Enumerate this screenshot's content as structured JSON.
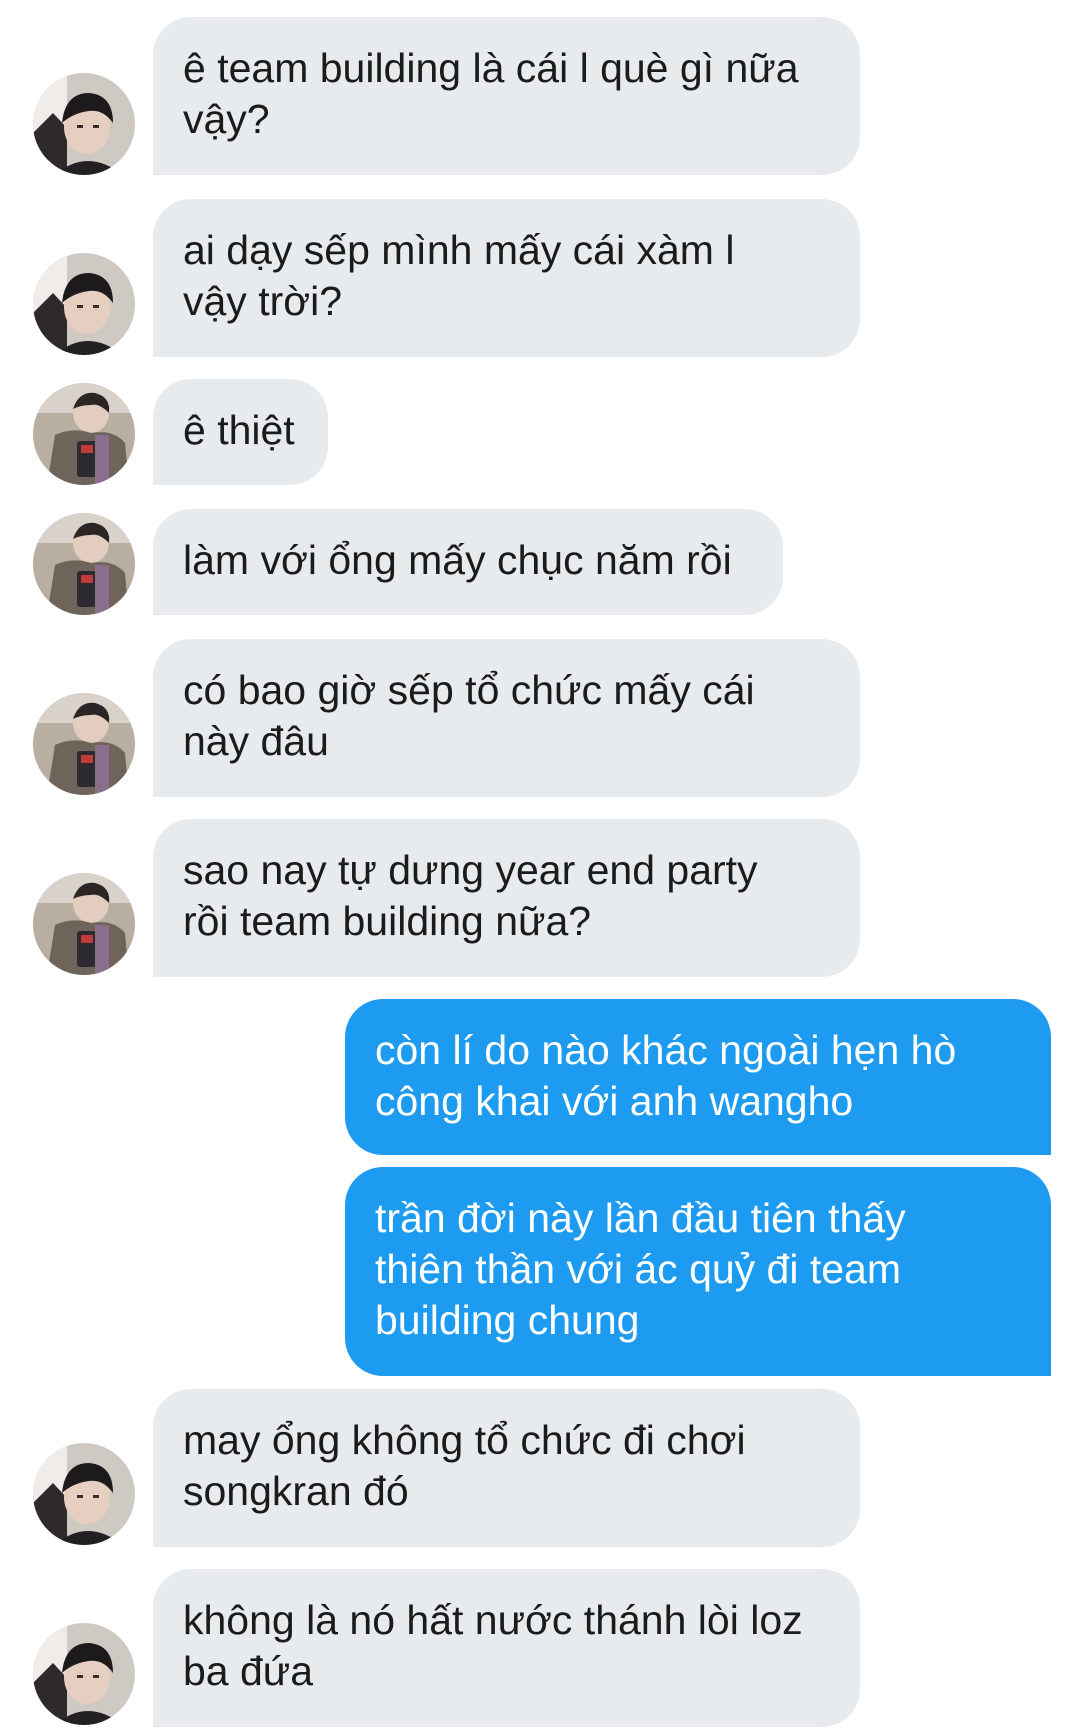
{
  "conversation": {
    "messages": [
      {
        "sender": "friend-a",
        "text": "ê team building là cái l què gì nữa\nvậy?"
      },
      {
        "sender": "friend-a",
        "text": "ai dạy sếp mình mấy cái xàm l\nvậy trời?"
      },
      {
        "sender": "friend-b",
        "text": "ê thiệt"
      },
      {
        "sender": "friend-b",
        "text": "làm với ổng mấy chục năm rồi"
      },
      {
        "sender": "friend-b",
        "text": "có bao giờ sếp tổ chức mấy cái\nnày đâu"
      },
      {
        "sender": "friend-b",
        "text": "sao nay tự dưng year end party\nrồi team building nữa?"
      },
      {
        "sender": "me",
        "text": "còn lí do nào khác ngoài hẹn hò\ncông khai với anh wangho"
      },
      {
        "sender": "me",
        "text": "trần đời này lần đầu tiên thấy\nthiên thần với ác quỷ đi team\nbuilding chung"
      },
      {
        "sender": "friend-a",
        "text": "may ổng không tổ chức đi chơi\nsongkran đó"
      },
      {
        "sender": "friend-a",
        "text": "không là nó hất nước thánh lòi loz\nba đứa"
      }
    ]
  },
  "colors": {
    "incoming_bubble": "#e8ebee",
    "outgoing_bubble": "#1d9bf0",
    "incoming_text": "#1b1b1b",
    "outgoing_text": "#ffffff"
  }
}
